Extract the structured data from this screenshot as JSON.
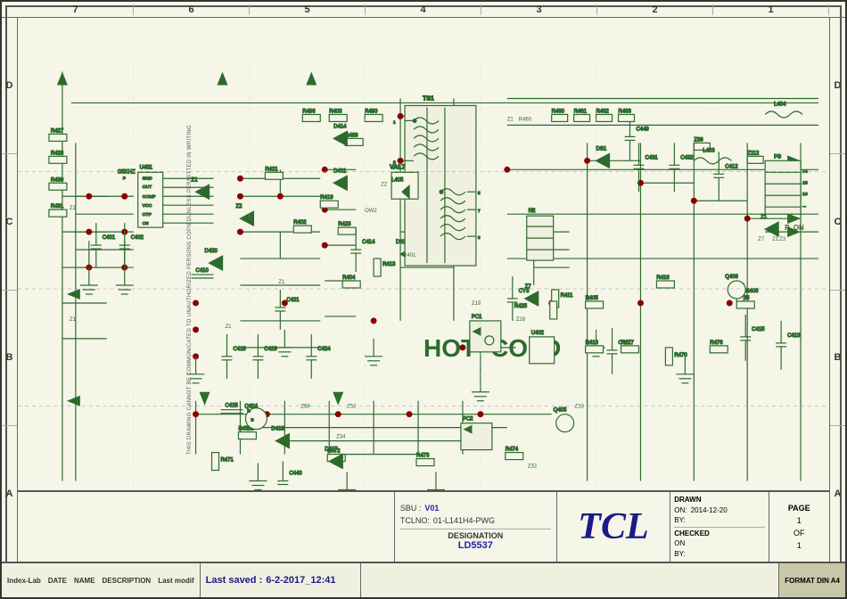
{
  "frame": {
    "col_labels": [
      "7",
      "6",
      "5",
      "4",
      "3",
      "2",
      "1"
    ],
    "row_labels": [
      "D",
      "C",
      "B",
      "A"
    ]
  },
  "labels": {
    "hot": "HOT",
    "cold": "COLD",
    "vertical_warning": "THIS DRAWING CANNOT BE COMMUNICATED TO UNAUTHORIZED PERSONS COPIEDUNLESS PERMITTED IN WRITING"
  },
  "bottom_bar": {
    "index_lab": "Index-Lab",
    "date_label": "DATE",
    "name_label": "NAME",
    "description_label": "DESCRIPTION",
    "last_modif_label": "Last modif",
    "last_saved_label": "Last saved :",
    "last_saved_value": "6-2-2017_12:41",
    "sbu_label": "SBU :",
    "sbu_value": "V01",
    "tclno_label": "TCLNO:",
    "tclno_value": "01-L141H4-PWG",
    "designation_label": "DESIGNATION",
    "designation_value": "LD5537",
    "tcl_brand": "TCL",
    "drawn_label": "DRAWN",
    "drawn_on": "ON:",
    "drawn_on_value": "2014-12-20",
    "drawn_by": "BY:",
    "checked_label": "CHECKED",
    "checked_on": "ON",
    "checked_by": "BY:",
    "page_label": "PAGE",
    "page_value": "1",
    "of_label": "OF",
    "of_value": "1",
    "format_label": "FORMAT DIN A4"
  },
  "components": {
    "resistors": [
      "R427",
      "R428",
      "R430",
      "R431",
      "R405",
      "R406",
      "R490",
      "R496",
      "R489",
      "R419",
      "R423",
      "R413",
      "R402",
      "R421",
      "R411",
      "R416",
      "R425",
      "R455",
      "R418",
      "R417",
      "R470",
      "R476",
      "R471",
      "R472",
      "R473",
      "R474",
      "R404"
    ],
    "capacitors": [
      "C401",
      "C402",
      "C410",
      "C418",
      "C419",
      "C421",
      "C424",
      "C431",
      "C432",
      "C412",
      "C415",
      "C413",
      "C417",
      "C425",
      "C440",
      "C449",
      "CY3"
    ],
    "transistors": [
      "Q406",
      "Q404",
      "Q405"
    ],
    "ics": [
      "U451",
      "U402"
    ],
    "diodes": [
      "D401",
      "D414",
      "D411",
      "D417",
      "D418"
    ],
    "inductors": [
      "L404",
      "L403",
      "Z36"
    ],
    "transformer": "TS1",
    "connector": "H2",
    "opto": "PC1",
    "mosfet": "VAL7"
  }
}
